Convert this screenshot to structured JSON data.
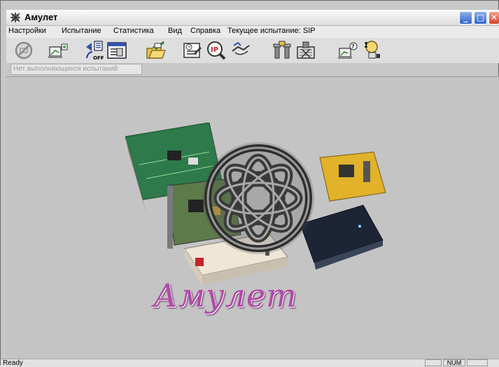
{
  "window": {
    "title": "Амулет",
    "minimize_glyph": "_",
    "maximize_glyph": "□",
    "close_glyph": "✕"
  },
  "menu": {
    "items": [
      "Настройки",
      "Испытание",
      "Статистика",
      "Вид",
      "Справка",
      "Текущее испытание: SIP"
    ]
  },
  "toolbar": {
    "buttons": [
      "stop-icon",
      "computer-icon",
      "off-icon",
      "report-icon",
      "folder-icon",
      "clock-icon",
      "ip-search-icon",
      "handshake-icon",
      "tools-icon",
      "hardware-icon",
      "network-icon",
      "ethernet-icon"
    ],
    "off_label": "OFF",
    "ip_label": "IP"
  },
  "test_status": "Нет выполняющихся испытаний",
  "logo_text": "Амулет",
  "statusbar": {
    "ready": "Ready",
    "num": "NUM"
  },
  "colors": {
    "client_bg": "#c4c4c4",
    "logo": "#b04aa8",
    "title_blue": "#2f62cf",
    "close_red": "#d6412a"
  }
}
